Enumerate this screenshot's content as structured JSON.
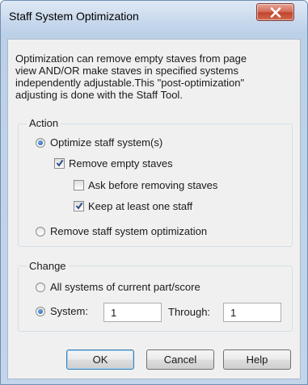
{
  "window": {
    "title": "Staff System Optimization"
  },
  "description": [
    "Optimization can remove empty staves from page",
    "view AND/OR make staves in specified systems",
    "independently adjustable.This \"post-optimization\"",
    "adjusting is done with the Staff Tool."
  ],
  "action": {
    "legend": "Action",
    "optimize_label": "Optimize staff system(s)",
    "optimize_selected": true,
    "remove_empty_label": "Remove empty staves",
    "remove_empty_checked": true,
    "ask_before_label": "Ask before removing staves",
    "ask_before_checked": false,
    "keep_one_label": "Keep at least one staff",
    "keep_one_checked": true,
    "remove_optimization_label": "Remove staff system optimization",
    "remove_optimization_selected": false
  },
  "change": {
    "legend": "Change",
    "all_systems_label": "All systems of current part/score",
    "all_systems_selected": false,
    "system_label": "System:",
    "system_selected": true,
    "system_value": "1",
    "through_label": "Through:",
    "through_value": "1"
  },
  "buttons": {
    "ok": "OK",
    "cancel": "Cancel",
    "help": "Help"
  },
  "colors": {
    "accent": "#1c5fb1",
    "close": "#c2452e",
    "title_bar": "#c6d7ec"
  }
}
